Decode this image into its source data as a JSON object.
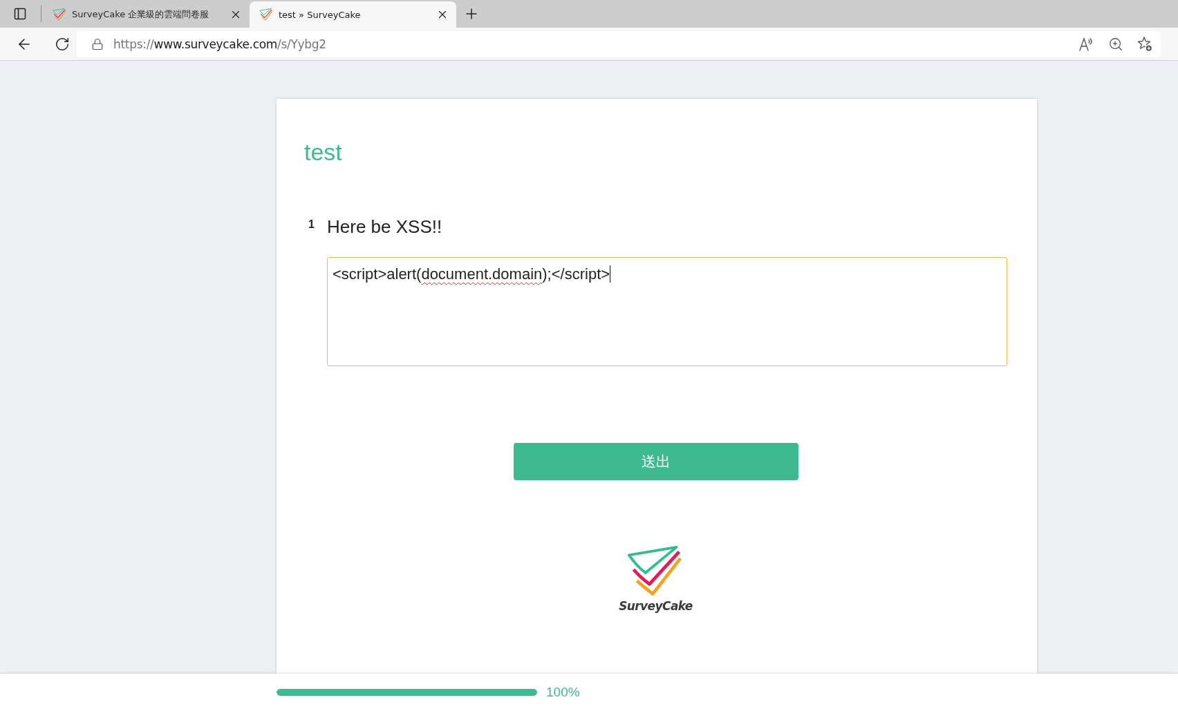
{
  "browser": {
    "tabs": [
      {
        "title": "SurveyCake 企業級的雲端問卷服",
        "selected": false
      },
      {
        "title": "test » SurveyCake",
        "selected": true
      }
    ],
    "address_bar": {
      "scheme": "https://",
      "host": "www.surveycake.com",
      "path": "/s/Yybg2"
    }
  },
  "survey": {
    "title": "test",
    "questions": [
      {
        "number": "1",
        "text": "Here be XSS!!",
        "kind": "long_text",
        "focused": true,
        "answer": [
          {
            "text": "<script>alert(",
            "misspelled": false
          },
          {
            "text": "document.domain",
            "misspelled": true
          },
          {
            "text": ");</script>",
            "misspelled": false
          }
        ]
      }
    ],
    "submit_button": "送出",
    "logo": {
      "wordmark": "SurveyCake"
    }
  },
  "progress": {
    "level": 1,
    "reading": "100%"
  }
}
